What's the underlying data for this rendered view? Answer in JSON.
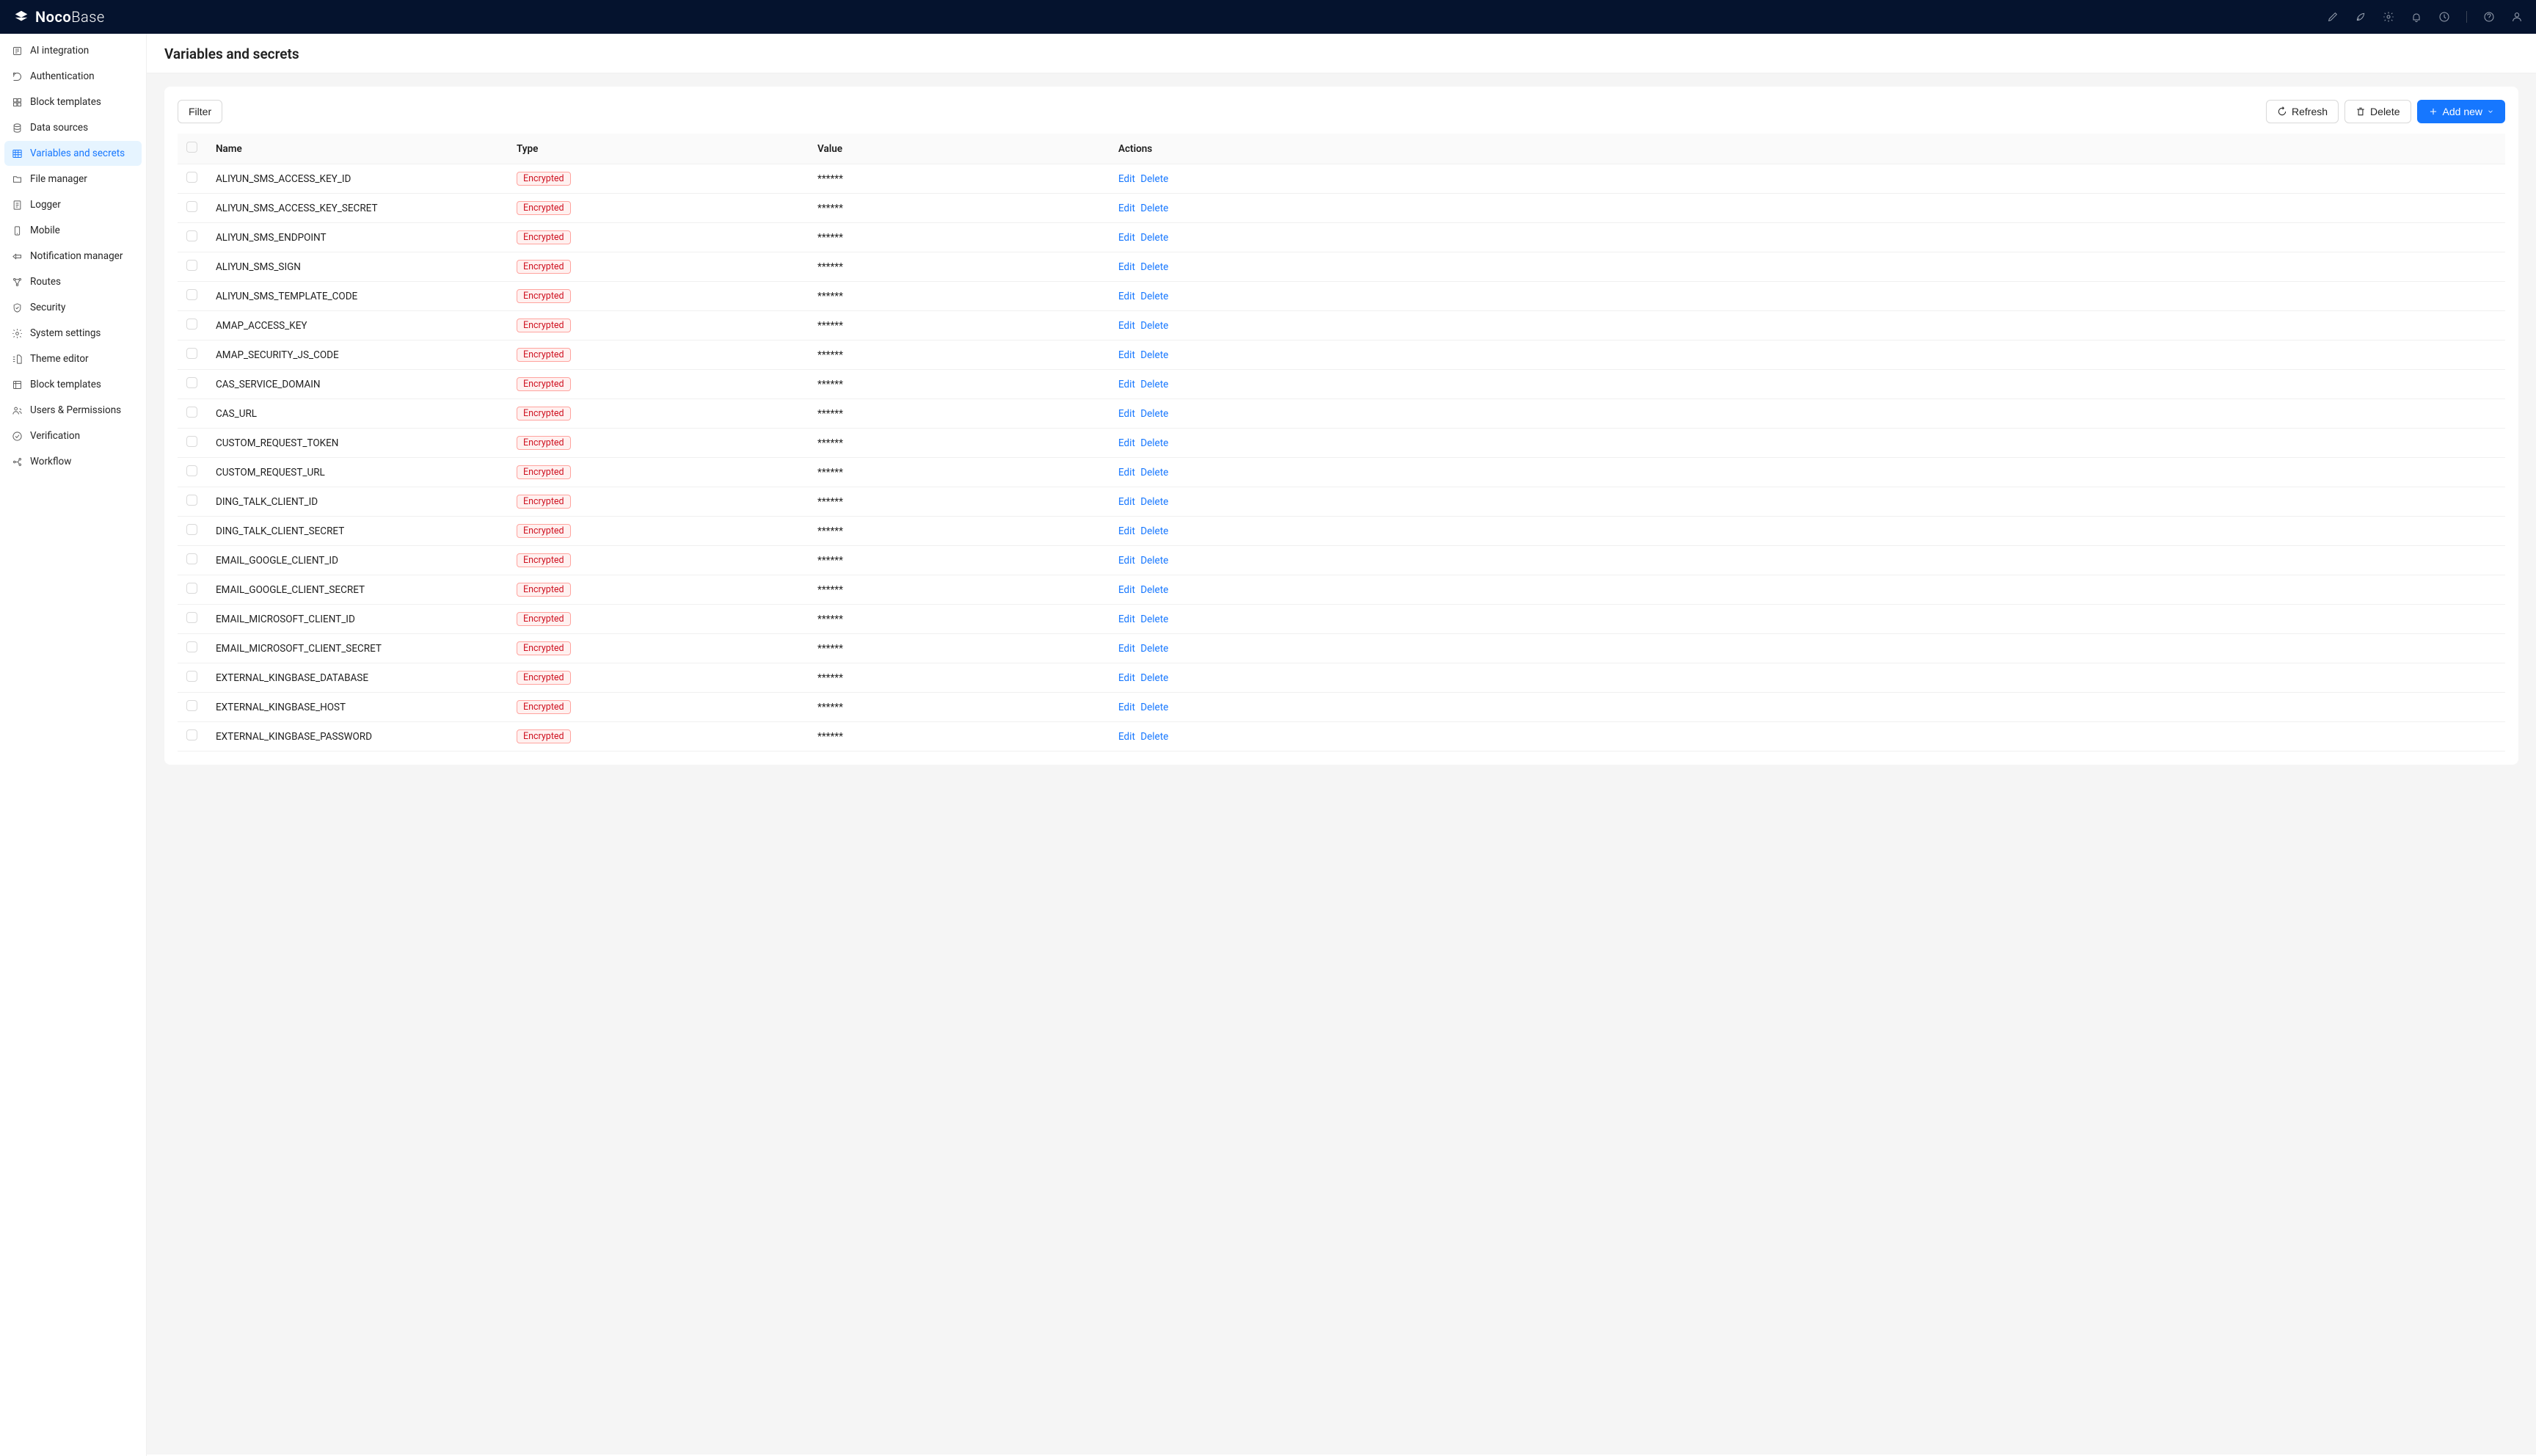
{
  "logo": {
    "bold": "Noco",
    "light": "Base"
  },
  "sidebar": {
    "items": [
      {
        "label": "AI integration",
        "id": "ai-integration"
      },
      {
        "label": "Authentication",
        "id": "authentication"
      },
      {
        "label": "Block templates",
        "id": "block-templates"
      },
      {
        "label": "Data sources",
        "id": "data-sources"
      },
      {
        "label": "Variables and secrets",
        "id": "variables-and-secrets",
        "active": true
      },
      {
        "label": "File manager",
        "id": "file-manager"
      },
      {
        "label": "Logger",
        "id": "logger"
      },
      {
        "label": "Mobile",
        "id": "mobile"
      },
      {
        "label": "Notification manager",
        "id": "notification-manager"
      },
      {
        "label": "Routes",
        "id": "routes"
      },
      {
        "label": "Security",
        "id": "security"
      },
      {
        "label": "System settings",
        "id": "system-settings"
      },
      {
        "label": "Theme editor",
        "id": "theme-editor"
      },
      {
        "label": "Block templates",
        "id": "block-templates-2"
      },
      {
        "label": "Users & Permissions",
        "id": "users-permissions"
      },
      {
        "label": "Verification",
        "id": "verification"
      },
      {
        "label": "Workflow",
        "id": "workflow"
      }
    ]
  },
  "page": {
    "title": "Variables and secrets"
  },
  "toolbar": {
    "filter": "Filter",
    "refresh": "Refresh",
    "delete": "Delete",
    "add_new": "Add new"
  },
  "table": {
    "columns": {
      "name": "Name",
      "type": "Type",
      "value": "Value",
      "actions": "Actions"
    },
    "type_label": "Encrypted",
    "masked_value": "******",
    "edit_label": "Edit",
    "delete_label": "Delete",
    "rows": [
      {
        "name": "ALIYUN_SMS_ACCESS_KEY_ID"
      },
      {
        "name": "ALIYUN_SMS_ACCESS_KEY_SECRET"
      },
      {
        "name": "ALIYUN_SMS_ENDPOINT"
      },
      {
        "name": "ALIYUN_SMS_SIGN"
      },
      {
        "name": "ALIYUN_SMS_TEMPLATE_CODE"
      },
      {
        "name": "AMAP_ACCESS_KEY"
      },
      {
        "name": "AMAP_SECURITY_JS_CODE"
      },
      {
        "name": "CAS_SERVICE_DOMAIN"
      },
      {
        "name": "CAS_URL"
      },
      {
        "name": "CUSTOM_REQUEST_TOKEN"
      },
      {
        "name": "CUSTOM_REQUEST_URL"
      },
      {
        "name": "DING_TALK_CLIENT_ID"
      },
      {
        "name": "DING_TALK_CLIENT_SECRET"
      },
      {
        "name": "EMAIL_GOOGLE_CLIENT_ID"
      },
      {
        "name": "EMAIL_GOOGLE_CLIENT_SECRET"
      },
      {
        "name": "EMAIL_MICROSOFT_CLIENT_ID"
      },
      {
        "name": "EMAIL_MICROSOFT_CLIENT_SECRET"
      },
      {
        "name": "EXTERNAL_KINGBASE_DATABASE"
      },
      {
        "name": "EXTERNAL_KINGBASE_HOST"
      },
      {
        "name": "EXTERNAL_KINGBASE_PASSWORD"
      }
    ]
  }
}
